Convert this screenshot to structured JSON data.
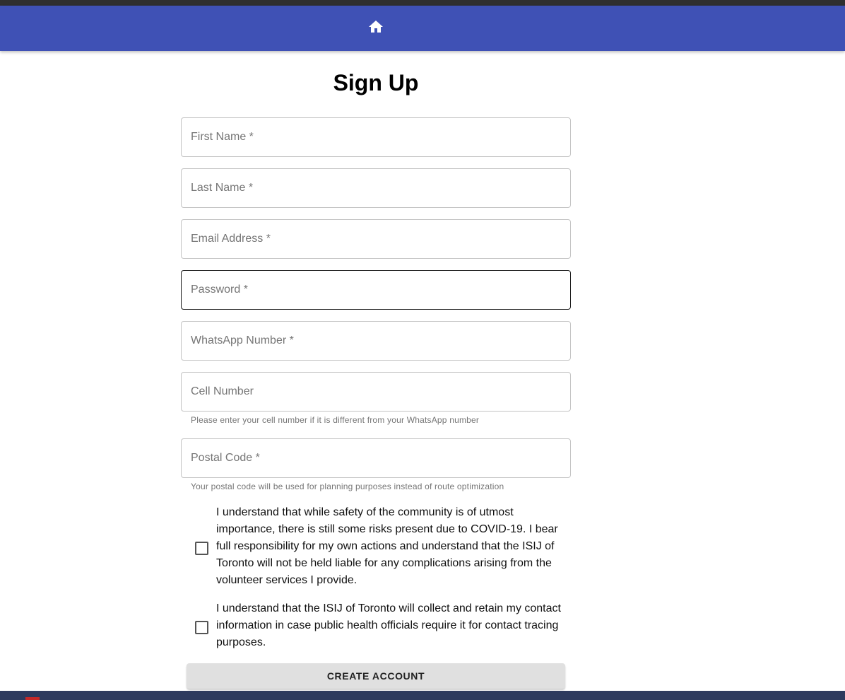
{
  "header": {
    "home_icon": "home-icon",
    "bar_color": "#3f51b5"
  },
  "page": {
    "title": "Sign Up"
  },
  "form": {
    "first_name_placeholder": "First Name *",
    "last_name_placeholder": "Last Name *",
    "email_placeholder": "Email Address *",
    "password_placeholder": "Password *",
    "whatsapp_placeholder": "WhatsApp Number *",
    "cell_placeholder": "Cell Number",
    "cell_helper": "Please enter your cell number if it is different from your WhatsApp number",
    "postal_placeholder": "Postal Code *",
    "postal_helper": "Your postal code will be used for planning purposes instead of route optimization",
    "consent_covid": "I understand that while safety of the community is of utmost importance, there is still some risks present due to COVID-19. I bear full responsibility for my own actions and understand that the ISIJ of Toronto will not be held liable for any complications arising from the volunteer services I provide.",
    "consent_contact": "I understand that the ISIJ of Toronto will collect and retain my contact information in case public health officials require it for contact tracing purposes.",
    "submit_label": "CREATE ACCOUNT"
  }
}
